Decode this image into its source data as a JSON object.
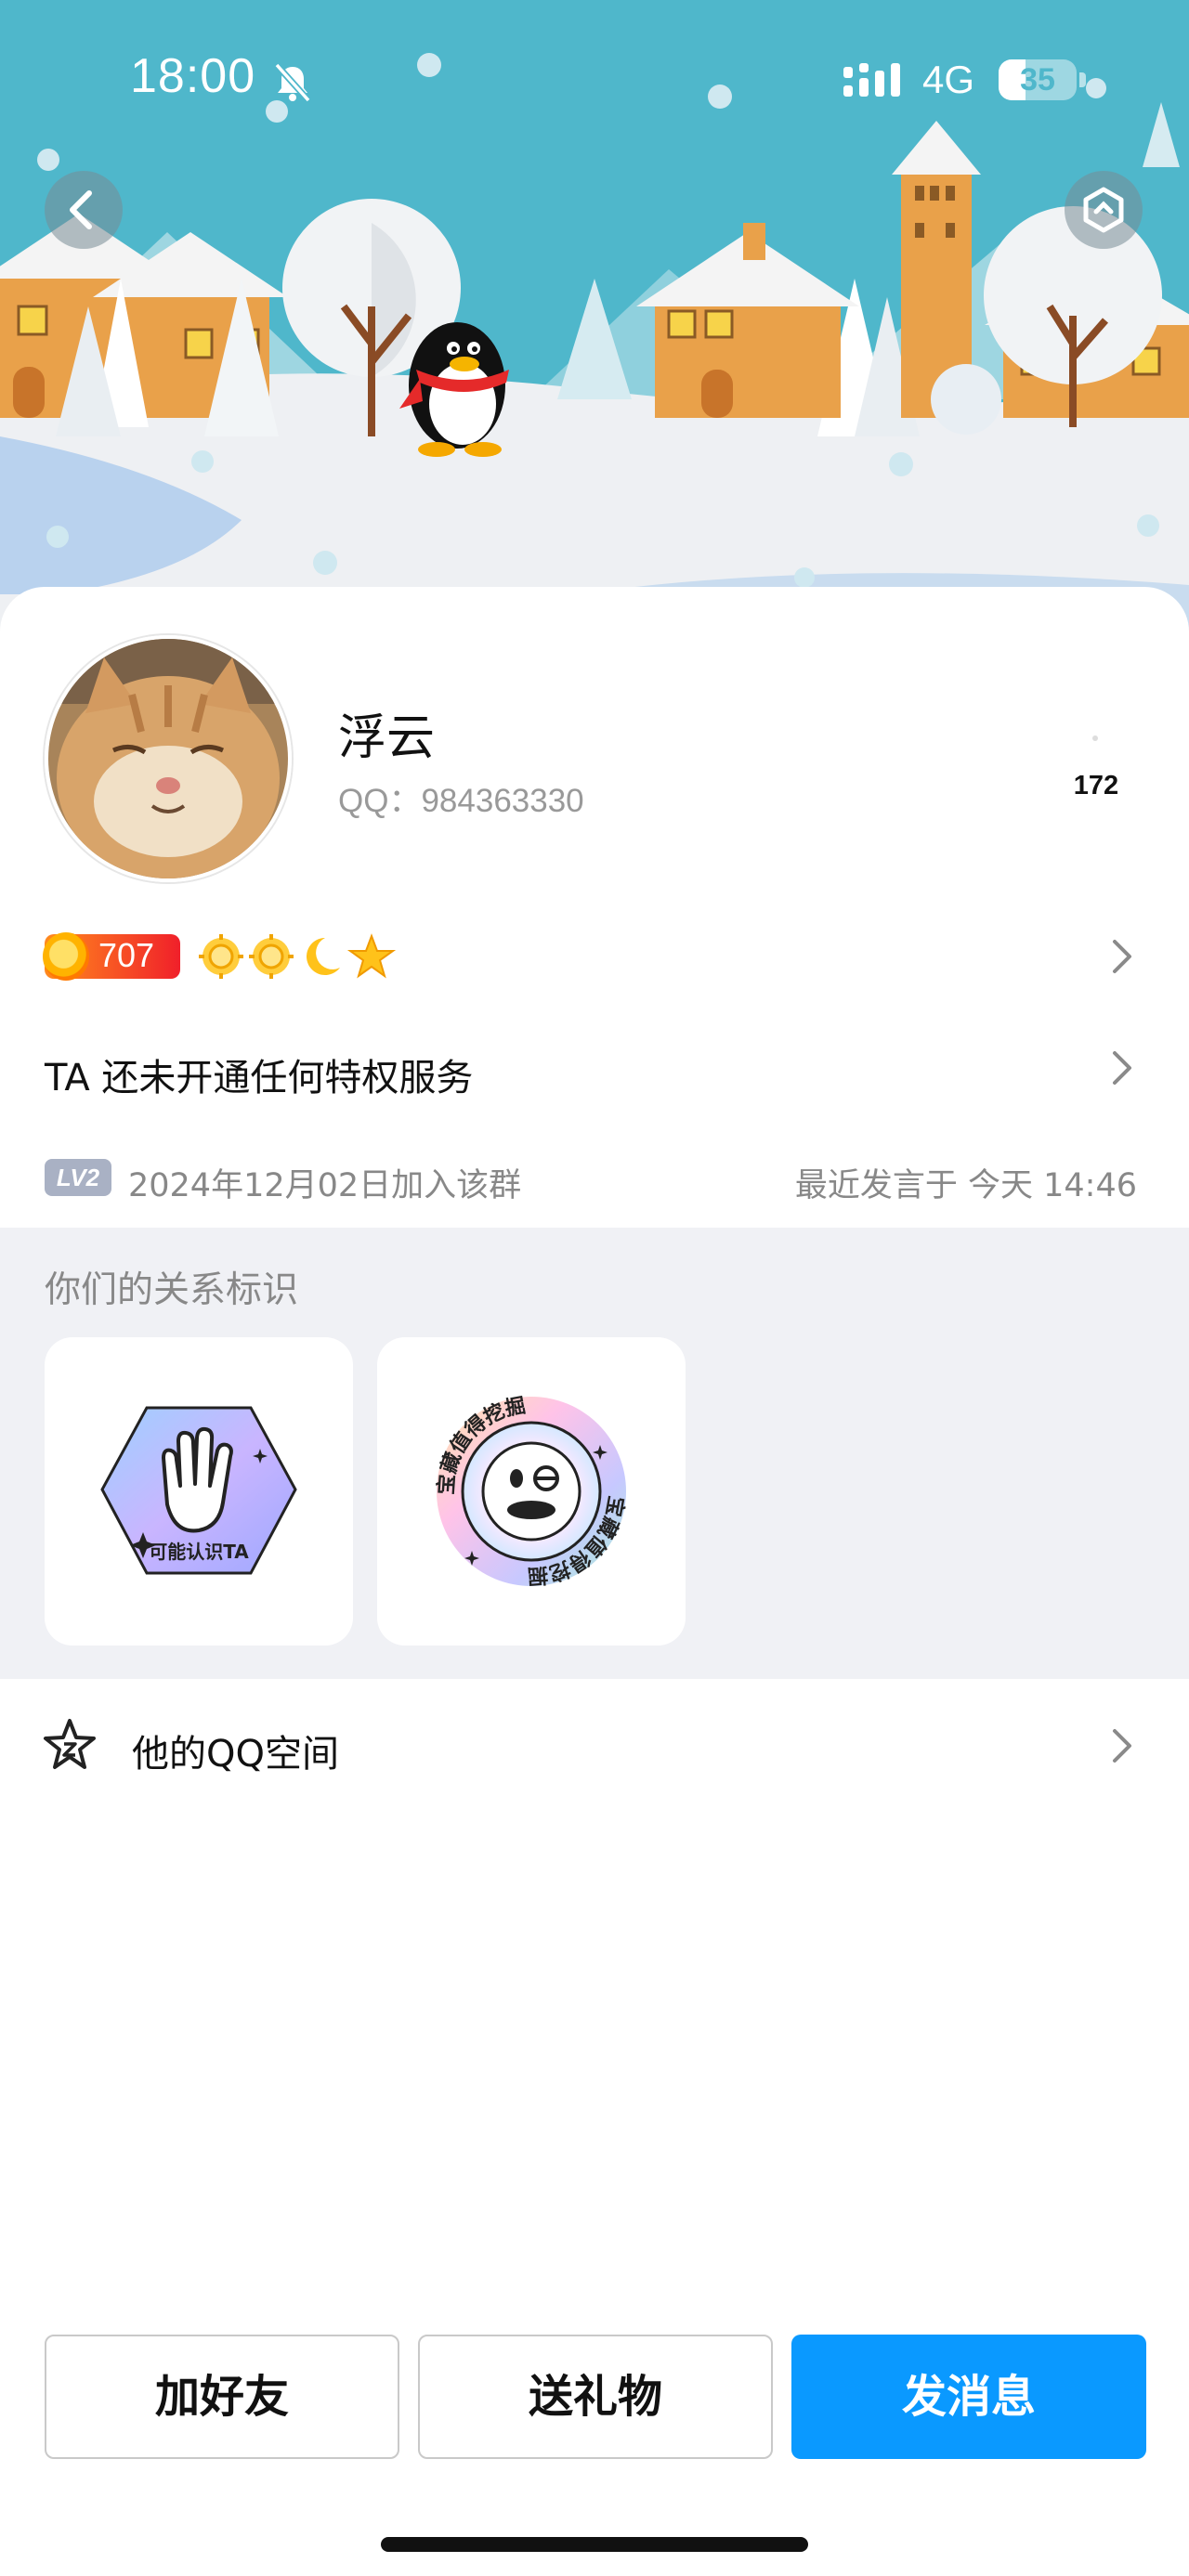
{
  "status_bar": {
    "time": "18:00",
    "network": "4G",
    "battery": "35",
    "battery_level": 0.35,
    "icons": [
      "bell-muted-icon",
      "signal-icon",
      "battery-icon"
    ]
  },
  "header": {
    "back_icon": "chevron-left-icon",
    "settings_icon": "hexagon-settings-icon"
  },
  "profile": {
    "nickname": "浮云",
    "qq_label": "QQ：",
    "qq_number": "984363330",
    "like_count": "172",
    "coin_value": "707",
    "level_icons": [
      "sun-icon",
      "sun-icon",
      "moon-icon",
      "star-icon"
    ],
    "privilege_text": "TA 还未开通任何特权服务",
    "group_level": "LV2",
    "join_text": "2024年12月02日加入该群",
    "last_speak_text": "最近发言于 今天 14:46"
  },
  "relation": {
    "title": "你们的关系标识",
    "badges": [
      {
        "label": "可能认识TA",
        "icon": "wave-hand-icon"
      },
      {
        "label": "宝藏值得挖掘",
        "icon": "treasure-face-icon"
      }
    ]
  },
  "qzone": {
    "label": "他的QQ空间",
    "icon": "star-outline-icon"
  },
  "actions": {
    "add_friend": "加好友",
    "send_gift": "送礼物",
    "send_message": "发消息"
  },
  "colors": {
    "banner_sky": "#4fb7cb",
    "primary_blue": "#0a99ff",
    "section_bg": "#f0f1f5"
  }
}
